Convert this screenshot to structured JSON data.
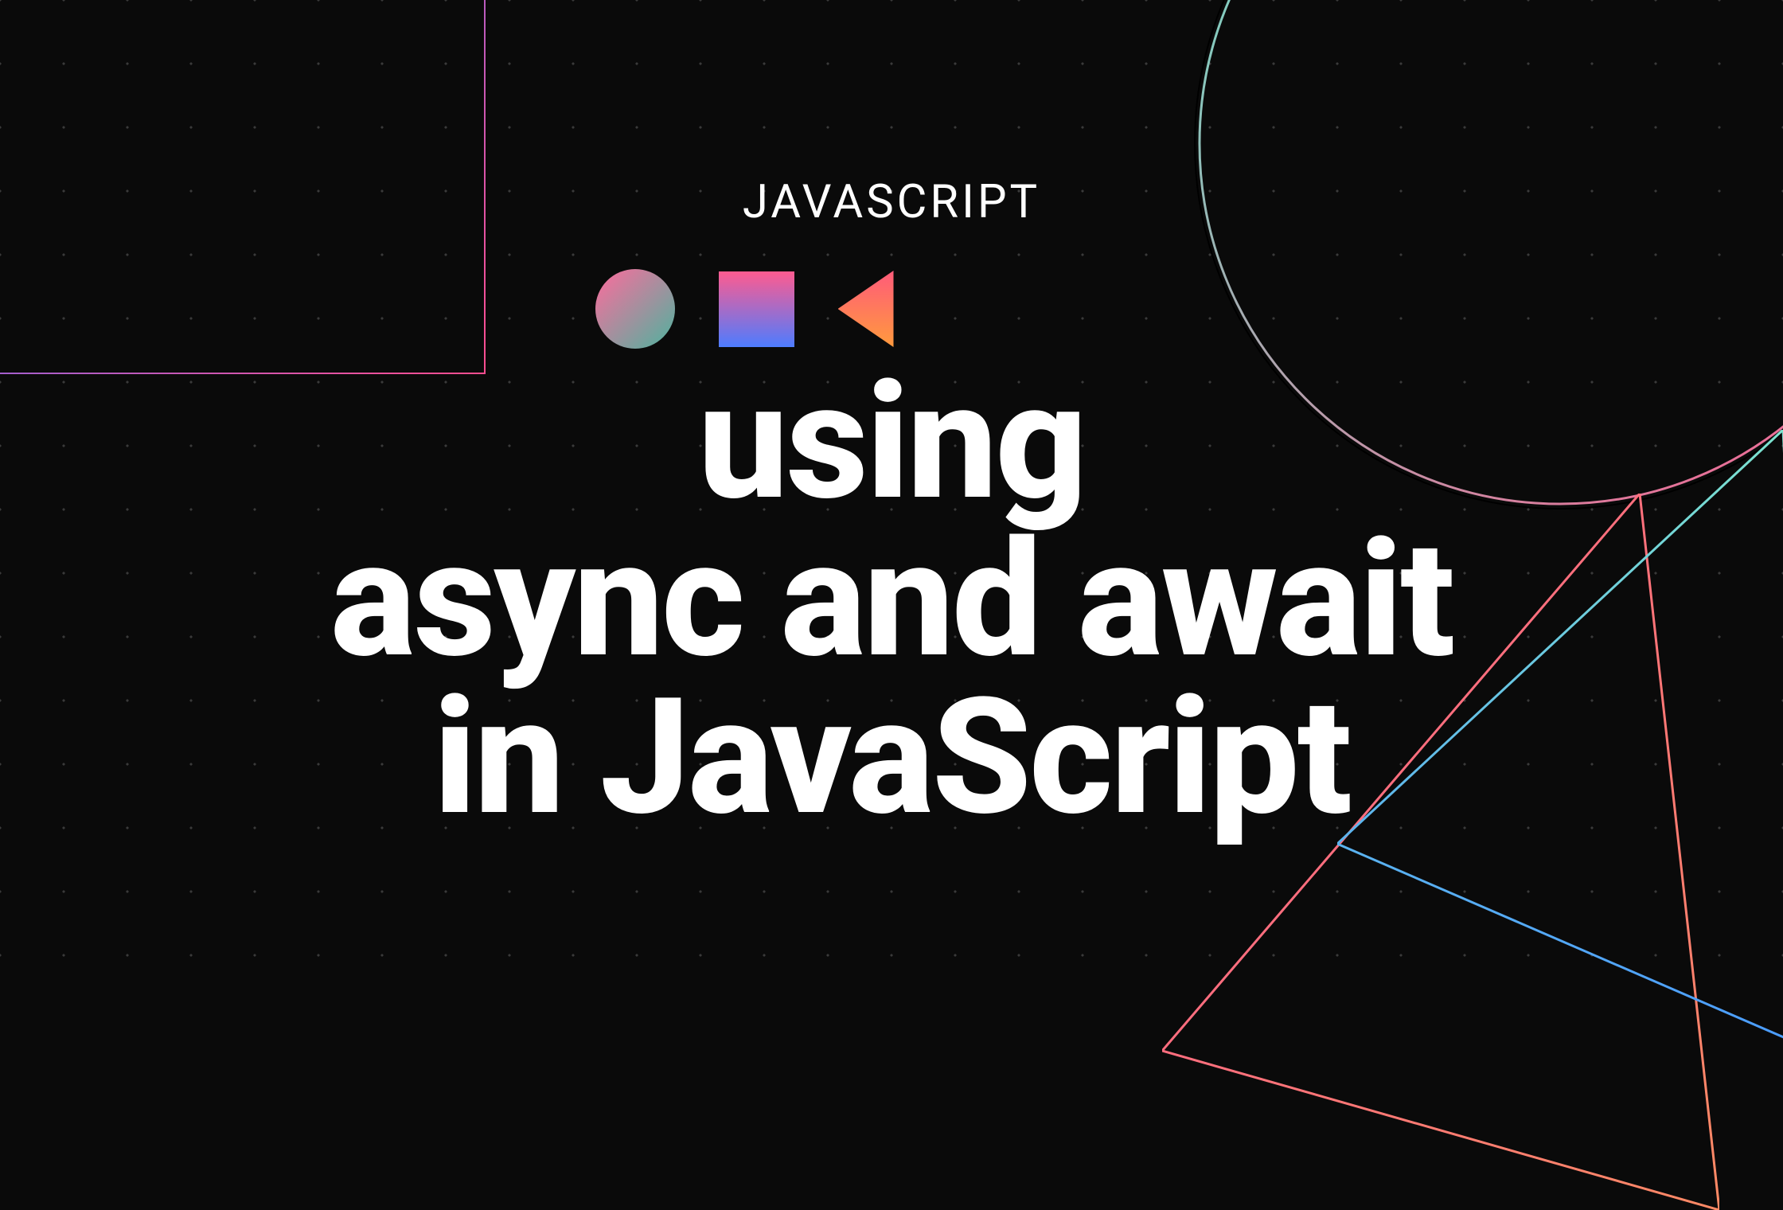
{
  "category": "JAVASCRIPT",
  "title_line1": "using",
  "title_line2": "async and await",
  "title_line3": "in JavaScript",
  "shapes": {
    "circle": "gradient-circle-icon",
    "square": "gradient-square-icon",
    "triangle": "gradient-triangle-icon"
  },
  "decor": {
    "corner_box": "gradient-corner-outline",
    "big_circle": "gradient-large-circle-outline",
    "pink_triangle": "pink-triangle-outline",
    "teal_triangle": "teal-triangle-outline"
  }
}
